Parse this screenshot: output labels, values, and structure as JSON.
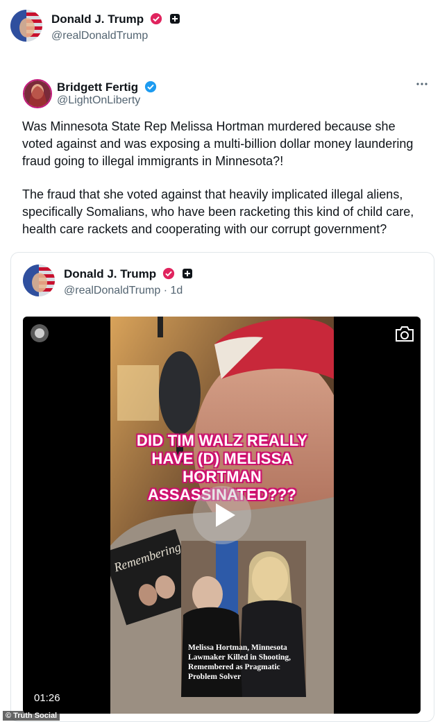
{
  "header": {
    "name": "Donald J. Trump",
    "handle": "@realDonaldTrump"
  },
  "quoted_post": {
    "name": "Bridgett Fertig",
    "handle": "@LightOnLiberty",
    "paragraph_1": "Was Minnesota State Rep Melissa Hortman murdered because she voted against and was exposing a multi-billion dollar money laundering fraud going to illegal immigrants in Minnesota?!",
    "paragraph_2": "The fraud that she voted against that heavily implicated illegal aliens, specifically Somalians, who have been racketing this kind of child care, health care rackets and cooperating with our corrupt government?"
  },
  "nested_post": {
    "name": "Donald J. Trump",
    "handle_time": "@realDonaldTrump · 1d"
  },
  "video": {
    "overlay_text": "DID TIM WALZ REALLY HAVE (D) MELISSA HORTMAN ASSASSINATED???",
    "news_caption": "Melissa Hortman, Minnesota Lawmaker Killed in Shooting, Remembered as Pragmatic Problem Solver",
    "book_title": "Remembering",
    "timecode": "01:26"
  },
  "watermark": "© Truth Social",
  "colors": {
    "verified_pink": "#e0245e",
    "verified_blue": "#1d9bf0",
    "overlay_pink": "#e0177a"
  },
  "icons": [
    "verified-badge-icon",
    "plus-square-icon",
    "more-icon",
    "camera-icon",
    "play-icon",
    "record-icon"
  ]
}
